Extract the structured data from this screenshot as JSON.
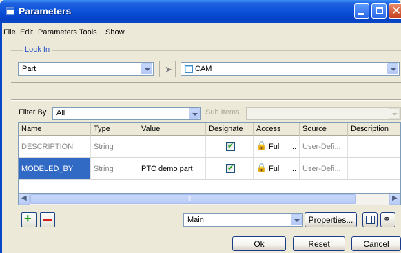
{
  "window": {
    "title": "Parameters"
  },
  "menu": [
    "File",
    "Edit",
    "Parameters",
    "Tools",
    "Show"
  ],
  "look_in": {
    "label": "Look In",
    "type_value": "Part",
    "item_value": "CAM"
  },
  "filter": {
    "label": "Filter By",
    "value": "All",
    "sub_items_label": "Sub Items"
  },
  "table": {
    "columns": [
      "Name",
      "Type",
      "Value",
      "Designate",
      "Access",
      "Source",
      "Description"
    ],
    "rows": [
      {
        "name": "DESCRIPTION",
        "type": "String",
        "value": "",
        "designate": true,
        "access": "Full",
        "access_more": "...",
        "source": "User-Defi..."
      },
      {
        "name": "MODELED_BY",
        "type": "String",
        "value": "PTC demo part",
        "designate": true,
        "access": "Full",
        "access_more": "...",
        "source": "User-Defi..."
      }
    ]
  },
  "bottom": {
    "view_value": "Main",
    "properties_label": "Properties...",
    "ok_label": "Ok",
    "reset_label": "Reset",
    "cancel_label": "Cancel"
  },
  "icons": [
    "parameters-app-icon",
    "minimize-icon",
    "maximize-icon",
    "close-icon",
    "pointer-icon",
    "cam-icon",
    "lock-icon",
    "checkmark-icon",
    "plus-icon",
    "minus-icon",
    "table-icon",
    "binoculars-icon"
  ]
}
